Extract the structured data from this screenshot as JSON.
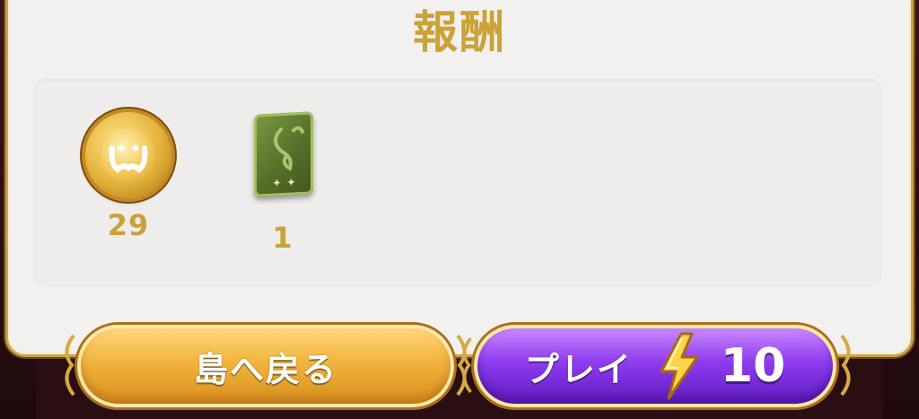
{
  "title": "報酬",
  "rewards": [
    {
      "icon": "gold-coin-icon",
      "quantity": "29"
    },
    {
      "icon": "green-card-pack-icon",
      "quantity": "1"
    }
  ],
  "buttons": {
    "back_label": "島へ戻る",
    "play_label": "プレイ",
    "play_cost_icon": "lightning-bolt-icon",
    "play_cost": "10"
  },
  "colors": {
    "gold_text": "#caa237",
    "back_button": "#f1b43c",
    "play_button": "#8f3bee",
    "panel": "#f3f1ef"
  }
}
